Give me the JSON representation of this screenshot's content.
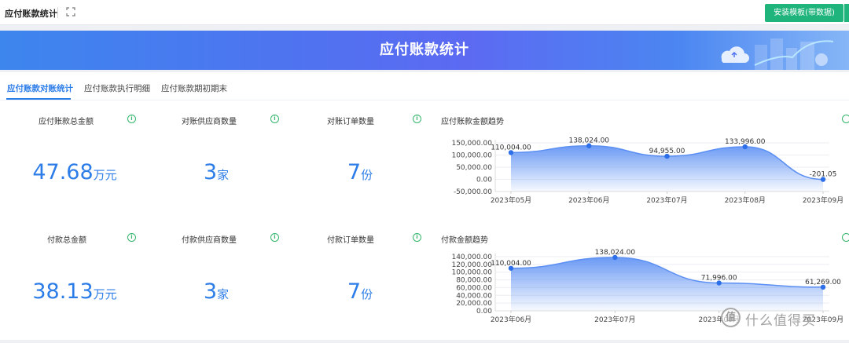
{
  "app": {
    "title": "应付账款统计",
    "install_button": "安装模板(带数据)"
  },
  "banner": {
    "title": "应付账款统计"
  },
  "tabs": [
    {
      "label": "应付账款对账统计",
      "active": true
    },
    {
      "label": "应付账款执行明细",
      "active": false
    },
    {
      "label": "应付账款期初期末",
      "active": false
    }
  ],
  "kpis": {
    "row1": [
      {
        "label": "应付账款总金额",
        "value": "47.68",
        "unit": "万元"
      },
      {
        "label": "对账供应商数量",
        "value": "3",
        "unit": "家"
      },
      {
        "label": "对账订单数量",
        "value": "7",
        "unit": "份"
      }
    ],
    "row2": [
      {
        "label": "付款总金额",
        "value": "38.13",
        "unit": "万元"
      },
      {
        "label": "付款供应商数量",
        "value": "3",
        "unit": "家"
      },
      {
        "label": "付款订单数量",
        "value": "7",
        "unit": "份"
      }
    ]
  },
  "info_icon_glyph": "i",
  "colors": {
    "accent": "#2d7de8",
    "install": "#1fb47c",
    "info": "#33b56a",
    "area_top": "#5b8ff3",
    "line": "#5b8ff3",
    "point": "#2d6fe8"
  },
  "chart_data": [
    {
      "type": "area",
      "title": "应付账款金额趋势",
      "categories": [
        "2023年05月",
        "2023年06月",
        "2023年07月",
        "2023年08月",
        "2023年09月"
      ],
      "values": [
        110004.0,
        138024.0,
        94955.0,
        133996.0,
        -201.05
      ],
      "data_labels": [
        "110,004.00",
        "138,024.00",
        "94,955.00",
        "133,996.00",
        "-201.05"
      ],
      "y_ticks": [
        "150,000.00",
        "100,000.00",
        "50,000.00",
        "0.00",
        "-50,000.00"
      ],
      "y_tick_values": [
        150000,
        100000,
        50000,
        0,
        -50000
      ],
      "ylim": [
        -50000,
        150000
      ],
      "xlabel": "",
      "ylabel": "",
      "grid": true
    },
    {
      "type": "area",
      "title": "付款金额趋势",
      "categories": [
        "2023年06月",
        "2023年07月",
        "2023年08月",
        "2023年09月"
      ],
      "values": [
        110004.0,
        138024.0,
        71996.0,
        61269.0
      ],
      "data_labels": [
        "110,004.00",
        "138,024.00",
        "71,996.00",
        "61,269.00"
      ],
      "y_ticks": [
        "140,000.00",
        "120,000.00",
        "100,000.00",
        "80,000.00",
        "60,000.00",
        "40,000.00",
        "20,000.00",
        "0.00"
      ],
      "y_tick_values": [
        140000,
        120000,
        100000,
        80000,
        60000,
        40000,
        20000,
        0
      ],
      "ylim": [
        0,
        140000
      ],
      "xlabel": "",
      "ylabel": "",
      "grid": true
    }
  ],
  "watermark": {
    "glyph": "值",
    "text": "什么值得买"
  }
}
